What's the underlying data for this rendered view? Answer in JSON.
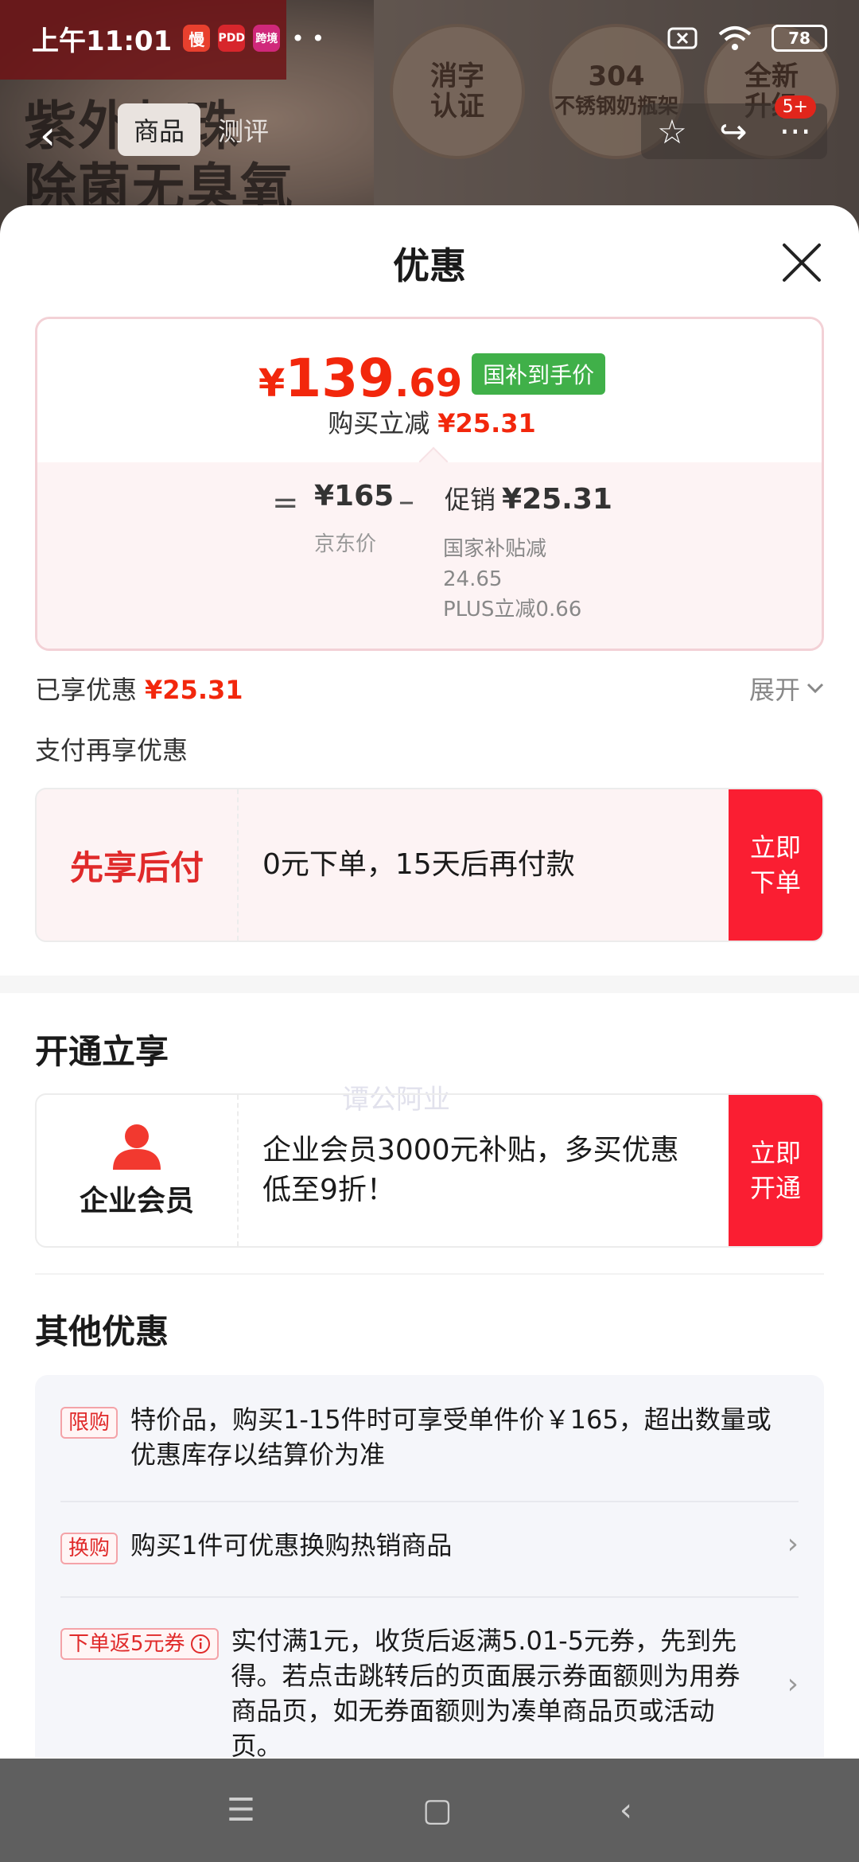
{
  "status_bar": {
    "time": "上午11:01",
    "apps": [
      "慢",
      "PDD",
      "跨境"
    ],
    "dots": "• •",
    "battery": "78"
  },
  "product_page": {
    "headline_lines": [
      "紫外灯珠",
      "除菌无臭氧"
    ],
    "badges": [
      {
        "line1": "消字",
        "line2": "认证"
      },
      {
        "line1": "304",
        "line2": "不锈钢奶瓶架"
      },
      {
        "line1": "全新",
        "line2": "升级"
      }
    ],
    "nav": {
      "tab_active": "商品",
      "tab_other": "测评",
      "badge": "5+"
    }
  },
  "sheet": {
    "title": "优惠",
    "price": {
      "currency": "¥",
      "integer": "139",
      "decimal": ".69",
      "tag": "国补到手价",
      "sub_label": "购买立减",
      "sub_amount": "¥25.31"
    },
    "calc": {
      "eq": "=",
      "jd_price": "¥165",
      "jd_label": "京东价",
      "minus": "–",
      "promo_label": "促销",
      "promo_amount": "¥25.31",
      "detail_line1": "国家补贴减",
      "detail_line2": "24.65",
      "detail_line3": "PLUS立减0.66"
    },
    "enjoyed_label": "已享优惠",
    "enjoyed_amount": "¥25.31",
    "expand_label": "展开",
    "pay_more_label": "支付再享优惠",
    "bnpl": {
      "title": "先享后付",
      "desc": "0元下单，15天后再付款",
      "button_line1": "立即",
      "button_line2": "下单",
      "watermark": "谭公阿业"
    },
    "open_section": {
      "title": "开通立享",
      "member_label": "企业会员",
      "desc": "企业会员3000元补贴，多买优惠低至9折！",
      "button_line1": "立即",
      "button_line2": "开通"
    },
    "other_section": {
      "title": "其他优惠",
      "offers": [
        {
          "tag": "限购",
          "text": "特价品，购买1-15件时可享受单件价￥165，超出数量或优惠库存以结算价为准"
        },
        {
          "tag": "换购",
          "text": "购买1件可优惠换购热销商品"
        },
        {
          "tag": "下单返5元券",
          "text": "实付满1元，收货后返满5.01-5元券，先到先得。若点击跳转后的页面展示券面额则为用券商品页，如无券面额则为凑单商品页或活动页。"
        }
      ]
    }
  },
  "colors": {
    "accent_red": "#f2270c",
    "button_red": "#fa1e32",
    "tag_green": "#40b049"
  }
}
